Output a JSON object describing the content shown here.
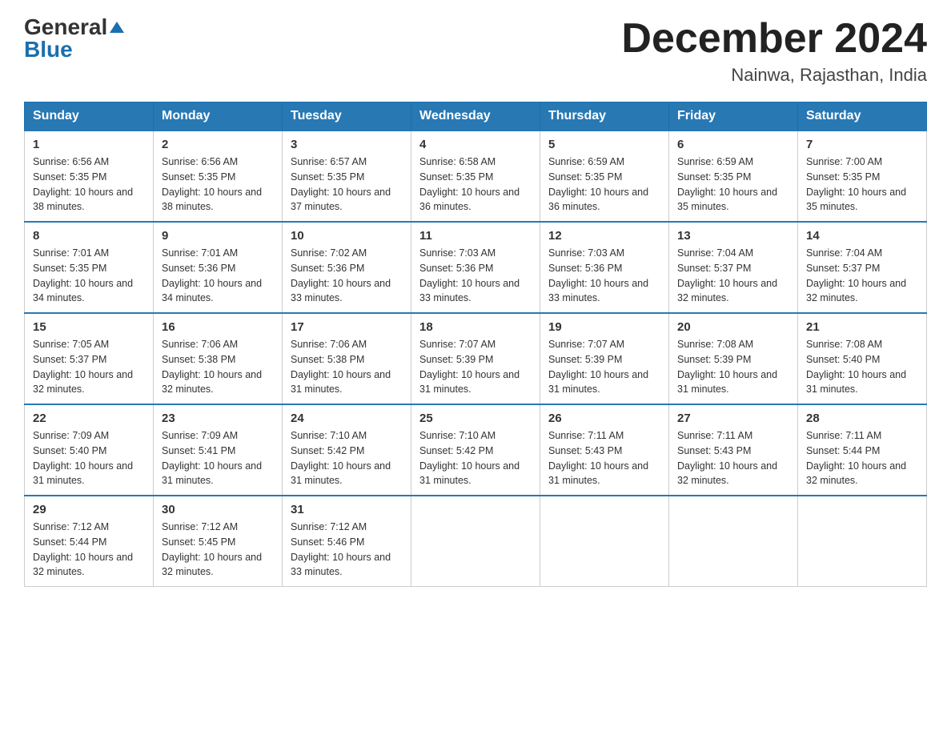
{
  "logo": {
    "general": "General",
    "blue": "Blue"
  },
  "title": "December 2024",
  "location": "Nainwa, Rajasthan, India",
  "headers": [
    "Sunday",
    "Monday",
    "Tuesday",
    "Wednesday",
    "Thursday",
    "Friday",
    "Saturday"
  ],
  "weeks": [
    [
      {
        "day": "1",
        "sunrise": "6:56 AM",
        "sunset": "5:35 PM",
        "daylight": "10 hours and 38 minutes."
      },
      {
        "day": "2",
        "sunrise": "6:56 AM",
        "sunset": "5:35 PM",
        "daylight": "10 hours and 38 minutes."
      },
      {
        "day": "3",
        "sunrise": "6:57 AM",
        "sunset": "5:35 PM",
        "daylight": "10 hours and 37 minutes."
      },
      {
        "day": "4",
        "sunrise": "6:58 AM",
        "sunset": "5:35 PM",
        "daylight": "10 hours and 36 minutes."
      },
      {
        "day": "5",
        "sunrise": "6:59 AM",
        "sunset": "5:35 PM",
        "daylight": "10 hours and 36 minutes."
      },
      {
        "day": "6",
        "sunrise": "6:59 AM",
        "sunset": "5:35 PM",
        "daylight": "10 hours and 35 minutes."
      },
      {
        "day": "7",
        "sunrise": "7:00 AM",
        "sunset": "5:35 PM",
        "daylight": "10 hours and 35 minutes."
      }
    ],
    [
      {
        "day": "8",
        "sunrise": "7:01 AM",
        "sunset": "5:35 PM",
        "daylight": "10 hours and 34 minutes."
      },
      {
        "day": "9",
        "sunrise": "7:01 AM",
        "sunset": "5:36 PM",
        "daylight": "10 hours and 34 minutes."
      },
      {
        "day": "10",
        "sunrise": "7:02 AM",
        "sunset": "5:36 PM",
        "daylight": "10 hours and 33 minutes."
      },
      {
        "day": "11",
        "sunrise": "7:03 AM",
        "sunset": "5:36 PM",
        "daylight": "10 hours and 33 minutes."
      },
      {
        "day": "12",
        "sunrise": "7:03 AM",
        "sunset": "5:36 PM",
        "daylight": "10 hours and 33 minutes."
      },
      {
        "day": "13",
        "sunrise": "7:04 AM",
        "sunset": "5:37 PM",
        "daylight": "10 hours and 32 minutes."
      },
      {
        "day": "14",
        "sunrise": "7:04 AM",
        "sunset": "5:37 PM",
        "daylight": "10 hours and 32 minutes."
      }
    ],
    [
      {
        "day": "15",
        "sunrise": "7:05 AM",
        "sunset": "5:37 PM",
        "daylight": "10 hours and 32 minutes."
      },
      {
        "day": "16",
        "sunrise": "7:06 AM",
        "sunset": "5:38 PM",
        "daylight": "10 hours and 32 minutes."
      },
      {
        "day": "17",
        "sunrise": "7:06 AM",
        "sunset": "5:38 PM",
        "daylight": "10 hours and 31 minutes."
      },
      {
        "day": "18",
        "sunrise": "7:07 AM",
        "sunset": "5:39 PM",
        "daylight": "10 hours and 31 minutes."
      },
      {
        "day": "19",
        "sunrise": "7:07 AM",
        "sunset": "5:39 PM",
        "daylight": "10 hours and 31 minutes."
      },
      {
        "day": "20",
        "sunrise": "7:08 AM",
        "sunset": "5:39 PM",
        "daylight": "10 hours and 31 minutes."
      },
      {
        "day": "21",
        "sunrise": "7:08 AM",
        "sunset": "5:40 PM",
        "daylight": "10 hours and 31 minutes."
      }
    ],
    [
      {
        "day": "22",
        "sunrise": "7:09 AM",
        "sunset": "5:40 PM",
        "daylight": "10 hours and 31 minutes."
      },
      {
        "day": "23",
        "sunrise": "7:09 AM",
        "sunset": "5:41 PM",
        "daylight": "10 hours and 31 minutes."
      },
      {
        "day": "24",
        "sunrise": "7:10 AM",
        "sunset": "5:42 PM",
        "daylight": "10 hours and 31 minutes."
      },
      {
        "day": "25",
        "sunrise": "7:10 AM",
        "sunset": "5:42 PM",
        "daylight": "10 hours and 31 minutes."
      },
      {
        "day": "26",
        "sunrise": "7:11 AM",
        "sunset": "5:43 PM",
        "daylight": "10 hours and 31 minutes."
      },
      {
        "day": "27",
        "sunrise": "7:11 AM",
        "sunset": "5:43 PM",
        "daylight": "10 hours and 32 minutes."
      },
      {
        "day": "28",
        "sunrise": "7:11 AM",
        "sunset": "5:44 PM",
        "daylight": "10 hours and 32 minutes."
      }
    ],
    [
      {
        "day": "29",
        "sunrise": "7:12 AM",
        "sunset": "5:44 PM",
        "daylight": "10 hours and 32 minutes."
      },
      {
        "day": "30",
        "sunrise": "7:12 AM",
        "sunset": "5:45 PM",
        "daylight": "10 hours and 32 minutes."
      },
      {
        "day": "31",
        "sunrise": "7:12 AM",
        "sunset": "5:46 PM",
        "daylight": "10 hours and 33 minutes."
      },
      null,
      null,
      null,
      null
    ]
  ]
}
